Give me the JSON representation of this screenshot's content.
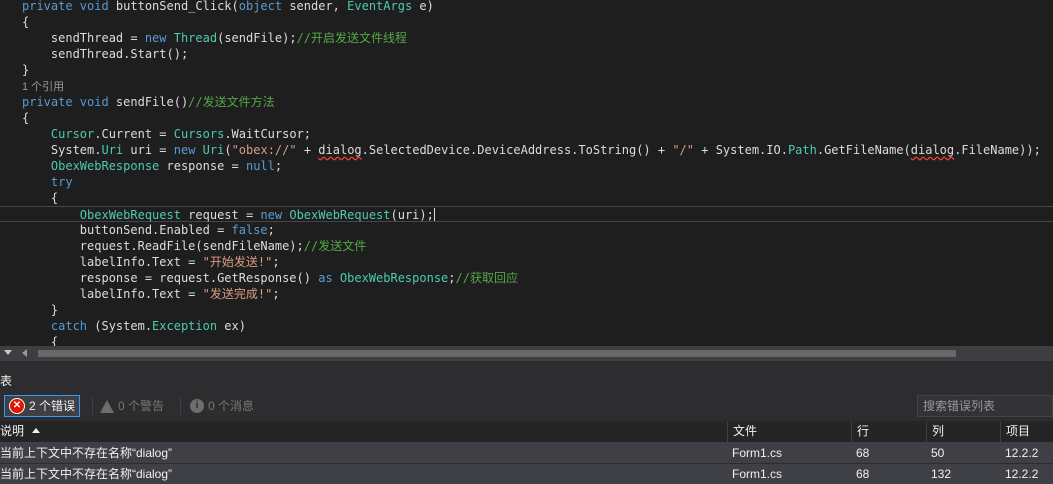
{
  "editor": {
    "lines": [
      [
        [
          "kw",
          "private void "
        ],
        [
          "plain",
          "buttonSend_Click("
        ],
        [
          "kw",
          "object"
        ],
        [
          "plain",
          " sender, "
        ],
        [
          "type",
          "EventArgs"
        ],
        [
          "plain",
          " e)"
        ]
      ],
      [
        [
          "plain",
          "{"
        ]
      ],
      [
        [
          "plain",
          "    sendThread = "
        ],
        [
          "kw",
          "new "
        ],
        [
          "type",
          "Thread"
        ],
        [
          "plain",
          "(sendFile);"
        ],
        [
          "com",
          "//开启发送文件线程"
        ]
      ],
      [
        [
          "plain",
          "    sendThread.Start();"
        ]
      ],
      [
        [
          "plain",
          "}"
        ]
      ],
      [
        [
          "ref",
          "1 个引用"
        ]
      ],
      [
        [
          "kw",
          "private void "
        ],
        [
          "plain",
          "sendFile()"
        ],
        [
          "com",
          "//发送文件方法"
        ]
      ],
      [
        [
          "plain",
          "{"
        ]
      ],
      [
        [
          "plain",
          "    "
        ],
        [
          "type",
          "Cursor"
        ],
        [
          "plain",
          ".Current = "
        ],
        [
          "type",
          "Cursors"
        ],
        [
          "plain",
          ".WaitCursor;"
        ]
      ],
      [
        [
          "plain",
          "    System."
        ],
        [
          "type",
          "Uri"
        ],
        [
          "plain",
          " uri = "
        ],
        [
          "kw",
          "new "
        ],
        [
          "type",
          "Uri"
        ],
        [
          "plain",
          "("
        ],
        [
          "str",
          "\"obex://\""
        ],
        [
          "plain",
          " + "
        ],
        [
          "err",
          "dialog"
        ],
        [
          "plain",
          ".SelectedDevice.DeviceAddress.ToString() + "
        ],
        [
          "str",
          "\"/\""
        ],
        [
          "plain",
          " + System.IO."
        ],
        [
          "type",
          "Path"
        ],
        [
          "plain",
          ".GetFileName("
        ],
        [
          "err",
          "dialog"
        ],
        [
          "plain",
          ".FileName));"
        ]
      ],
      [
        [
          "plain",
          "    "
        ],
        [
          "type",
          "ObexWebResponse"
        ],
        [
          "plain",
          " response = "
        ],
        [
          "kw",
          "null"
        ],
        [
          "plain",
          ";"
        ]
      ],
      [
        [
          "kw",
          "    try"
        ]
      ],
      [
        [
          "plain",
          "    {"
        ]
      ],
      [
        [
          "plain",
          "        "
        ],
        [
          "type",
          "ObexWebRequest"
        ],
        [
          "plain",
          " request = "
        ],
        [
          "kw",
          "new "
        ],
        [
          "type",
          "ObexWebRequest"
        ],
        [
          "plain",
          "(uri);"
        ],
        [
          "caret",
          ""
        ]
      ],
      [
        [
          "plain",
          "        buttonSend.Enabled = "
        ],
        [
          "kw",
          "false"
        ],
        [
          "plain",
          ";"
        ]
      ],
      [
        [
          "plain",
          "        request.ReadFile(sendFileName);"
        ],
        [
          "com",
          "//发送文件"
        ]
      ],
      [
        [
          "plain",
          "        labelInfo.Text = "
        ],
        [
          "str",
          "\"开始发送!\""
        ],
        [
          "plain",
          ";"
        ]
      ],
      [
        [
          "plain",
          "        response = request.GetResponse() "
        ],
        [
          "kw",
          "as "
        ],
        [
          "type",
          "ObexWebResponse"
        ],
        [
          "plain",
          ";"
        ],
        [
          "com",
          "//获取回应"
        ]
      ],
      [
        [
          "plain",
          "        labelInfo.Text = "
        ],
        [
          "str",
          "\"发送完成!\""
        ],
        [
          "plain",
          ";"
        ]
      ],
      [
        [
          "plain",
          "    }"
        ]
      ],
      [
        [
          "kw",
          "    catch "
        ],
        [
          "plain",
          "(System."
        ],
        [
          "type",
          "Exception"
        ],
        [
          "plain",
          " ex)"
        ]
      ],
      [
        [
          "plain",
          "    {"
        ]
      ]
    ]
  },
  "panel": {
    "title": "表",
    "errors_label": "2 个错误",
    "warnings_label": "0 个警告",
    "messages_label": "0 个消息",
    "search_placeholder": "搜索错误列表"
  },
  "table": {
    "columns": {
      "description": "说明",
      "file": "文件",
      "line": "行",
      "column": "列",
      "project": "项目"
    },
    "rows": [
      {
        "description": "当前上下文中不存在名称“dialog”",
        "file": "Form1.cs",
        "line": "68",
        "column": "50",
        "project": "12.2.2"
      },
      {
        "description": "当前上下文中不存在名称“dialog”",
        "file": "Form1.cs",
        "line": "68",
        "column": "132",
        "project": "12.2.2"
      }
    ]
  },
  "icons": {
    "error": "error-circle-icon",
    "warning": "warning-triangle-icon",
    "message": "info-circle-icon",
    "sort": "sort-ascending-icon",
    "zoom": "chevron-down-icon",
    "scroll_left": "scroll-left-arrow-icon"
  },
  "colors": {
    "editor_bg": "#1e1e1e",
    "keyword": "#569cd6",
    "type": "#4ec9b0",
    "string": "#d69d85",
    "comment": "#57a64a",
    "error_underline": "#fc3e36",
    "error_icon": "#e51400",
    "selection_border": "#3399ff"
  }
}
